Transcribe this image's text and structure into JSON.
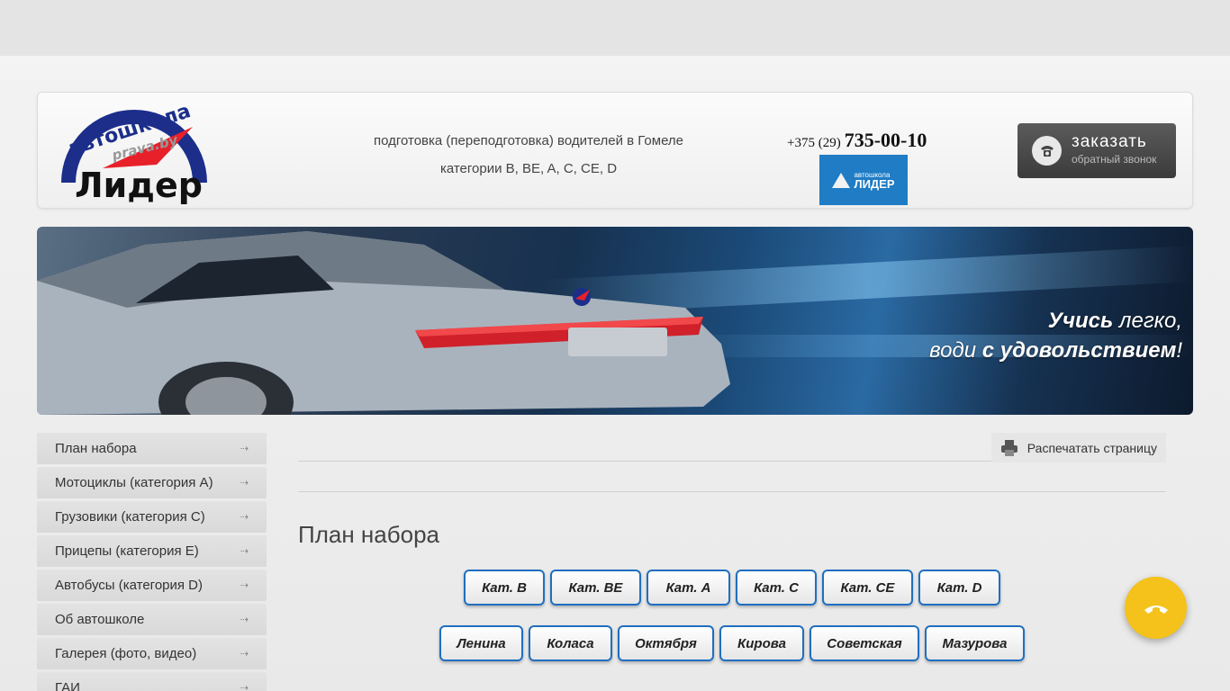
{
  "header": {
    "logo_top": "автошкола",
    "logo_site": "prava.by",
    "logo_name": "Лидер",
    "tagline_line1": "подготовка (переподготовка) водителей в Гомеле",
    "tagline_line2": "категории B, BE, A, C, CE, D",
    "phone_prefix": "+375 (29)",
    "phone_number": "735-00-10",
    "badge_small": "автошкола",
    "badge_big": "ЛИДЕР",
    "callback_label": "заказать",
    "callback_sub": "обратный звонок"
  },
  "banner": {
    "slogan_line1_bold": "Учись",
    "slogan_line1_rest": " легко,",
    "slogan_line2_start": "води ",
    "slogan_line2_bold": "с удовольствием",
    "slogan_line2_end": "!"
  },
  "sidebar": {
    "items": [
      {
        "label": "План набора"
      },
      {
        "label": "Мотоциклы (категория А)"
      },
      {
        "label": "Грузовики (категория С)"
      },
      {
        "label": "Прицепы (категория Е)"
      },
      {
        "label": "Автобусы (категория D)"
      },
      {
        "label": "Об автошколе"
      },
      {
        "label": "Галерея (фото, видео)"
      },
      {
        "label": "ГАИ"
      }
    ],
    "arrow": "⇢"
  },
  "content": {
    "print_label": "Распечатать страницу",
    "title": "План набора",
    "category_buttons": [
      "Кат. B",
      "Кат. BE",
      "Кат. A",
      "Кат. C",
      "Кат. CE",
      "Кат. D"
    ],
    "street_buttons": [
      "Ленина",
      "Коласа",
      "Октября",
      "Кирова",
      "Советская",
      "Мазурова"
    ]
  },
  "colors": {
    "accent_blue": "#1f6fc0",
    "logo_red": "#e8202a",
    "logo_navy": "#1c2e8a",
    "fab_yellow": "#f4c21a"
  },
  "icons": {
    "phone": "phone-icon",
    "printer": "printer-icon",
    "fab": "phone-hangup-icon",
    "arrow": "arrow-right-icon"
  }
}
